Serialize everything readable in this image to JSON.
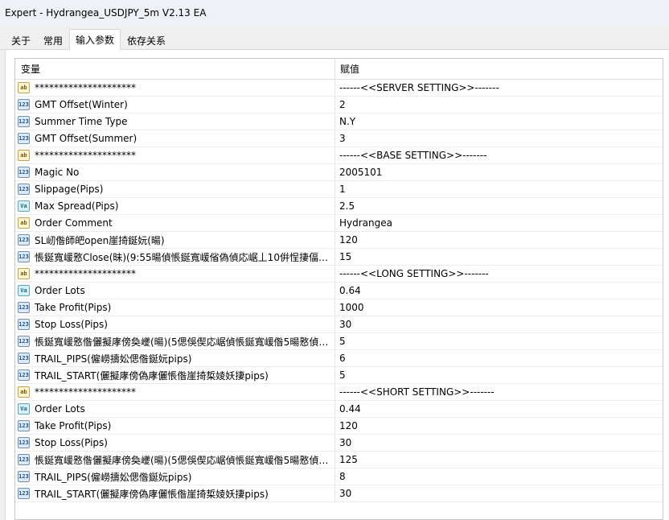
{
  "window": {
    "title": "Expert - Hydrangea_USDJPY_5m V2.13 EA"
  },
  "tabs": [
    {
      "label": "关于",
      "active": false
    },
    {
      "label": "常用",
      "active": false
    },
    {
      "label": "输入参数",
      "active": true
    },
    {
      "label": "依存关系",
      "active": false
    }
  ],
  "table": {
    "columns": {
      "variable": "变量",
      "value": "赋值"
    },
    "rows": [
      {
        "icon": "ab",
        "name": "*********************",
        "value": "------<<SERVER SETTING>>-------"
      },
      {
        "icon": "123",
        "name": "GMT Offset(Winter)",
        "value": "2"
      },
      {
        "icon": "123",
        "name": "Summer Time Type",
        "value": "N.Y"
      },
      {
        "icon": "123",
        "name": "GMT Offset(Summer)",
        "value": "3"
      },
      {
        "icon": "ab",
        "name": "*********************",
        "value": "------<<BASE SETTING>>-------"
      },
      {
        "icon": "123",
        "name": "Magic No",
        "value": "2005101"
      },
      {
        "icon": "123",
        "name": "Slippage(Pips)",
        "value": "1"
      },
      {
        "icon": "va",
        "name": "Max Spread(Pips)",
        "value": "2.5"
      },
      {
        "icon": "ab",
        "name": "Order Comment",
        "value": "Hydrangea"
      },
      {
        "icon": "123",
        "name": "SL屻偺師皅open崖掎鋋妧(暘)",
        "value": "120"
      },
      {
        "icon": "123",
        "name": "悵鋋寬嵈憝Close(昧)(9:55暘偵悵鋋寬嵈偗偽偵応崌丄10倂悜捿偪偲?...",
        "value": "15"
      },
      {
        "icon": "ab",
        "name": "*********************",
        "value": "------<<LONG SETTING>>-------"
      },
      {
        "icon": "va",
        "name": "Order Lots",
        "value": "0.64"
      },
      {
        "icon": "123",
        "name": "Take Profit(Pips)",
        "value": "1000"
      },
      {
        "icon": "123",
        "name": "Stop Loss(Pips)",
        "value": "30"
      },
      {
        "icon": "123",
        "name": "悵鋋寬嵈憝偺儷擬庨傍奐巙(暘)(5偲俁偰応崌偵悵鋋寬嵈偺5暘憝偵偳?...",
        "value": "5"
      },
      {
        "icon": "123",
        "name": "TRAIL_PIPS(僱嶗擣妐偲偺鋋妧pips)",
        "value": "6"
      },
      {
        "icon": "123",
        "name": "TRAIL_START(儷擬庨傍偽庨儷悵偺崖掎梊婈妖捿pips)",
        "value": "5"
      },
      {
        "icon": "ab",
        "name": "*********************",
        "value": "------<<SHORT SETTING>>-------"
      },
      {
        "icon": "va",
        "name": "Order Lots",
        "value": "0.44"
      },
      {
        "icon": "123",
        "name": "Take Profit(Pips)",
        "value": "120"
      },
      {
        "icon": "123",
        "name": "Stop Loss(Pips)",
        "value": "30"
      },
      {
        "icon": "123",
        "name": "悵鋋寬嵈憝偺儷擬庨傍奐巙(暘)(5偲俁偰応崌偵悵鋋寬嵈偺5暘憝偵偳?...",
        "value": "125"
      },
      {
        "icon": "123",
        "name": "TRAIL_PIPS(僱嶗擣妐偲偺鋋妧pips)",
        "value": "8"
      },
      {
        "icon": "123",
        "name": "TRAIL_START(儷擬庨傍偽庨儷悵偺崖掎梊婈妖捿pips)",
        "value": "30"
      }
    ]
  }
}
